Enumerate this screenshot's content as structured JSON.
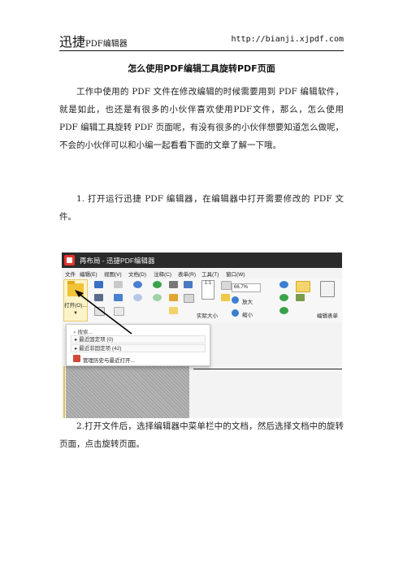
{
  "header": {
    "brand": "迅捷",
    "brand_sub": "PDF编辑器",
    "url": "http://bianji.xjpdf.com"
  },
  "title": "怎么使用PDF编辑工具旋转PDF页面",
  "paragraphs": [
    "工作中使用的 PDF 文件在修改编辑的时候需要用到 PDF 编辑软件，就是如此，也还是有很多的小伙伴喜欢使用PDF文件，那么，怎么使用 PDF 编辑工具旋转 PDF 页面呢，有没有很多的小伙伴想要知道怎么做呢，不会的小伙伴可以和小编一起看看下面的文章了解一下哦。",
    "1. 打开运行迅捷 PDF 编辑器，在编辑器中打开需要修改的 PDF 文件。",
    "2.打开文件后，选择编辑器中菜单栏中的文档，然后选择文档中的旋转页面，点击旋转页面。"
  ],
  "screenshot": {
    "window_title": "再布局 - 迅捷PDF编辑器",
    "menu": [
      "文件",
      "编辑(E)",
      "视图(V)",
      "文档(D)",
      "注释(C)",
      "表单(R)",
      "工具(T)",
      "窗口(W)"
    ],
    "open_label": "打开(O)...",
    "zoom_value": "66.7%",
    "actual_size_label": "实际大小",
    "zoom_in_label": "放大",
    "zoom_out_label": "缩小",
    "edit_form_label": "编辑表单",
    "dropdown": {
      "search_placeholder": "搜索...",
      "pinned": "最近固定项 (0)",
      "recent": "最近非固定项 (42)",
      "manage": "管理历史与最近打开..."
    }
  }
}
